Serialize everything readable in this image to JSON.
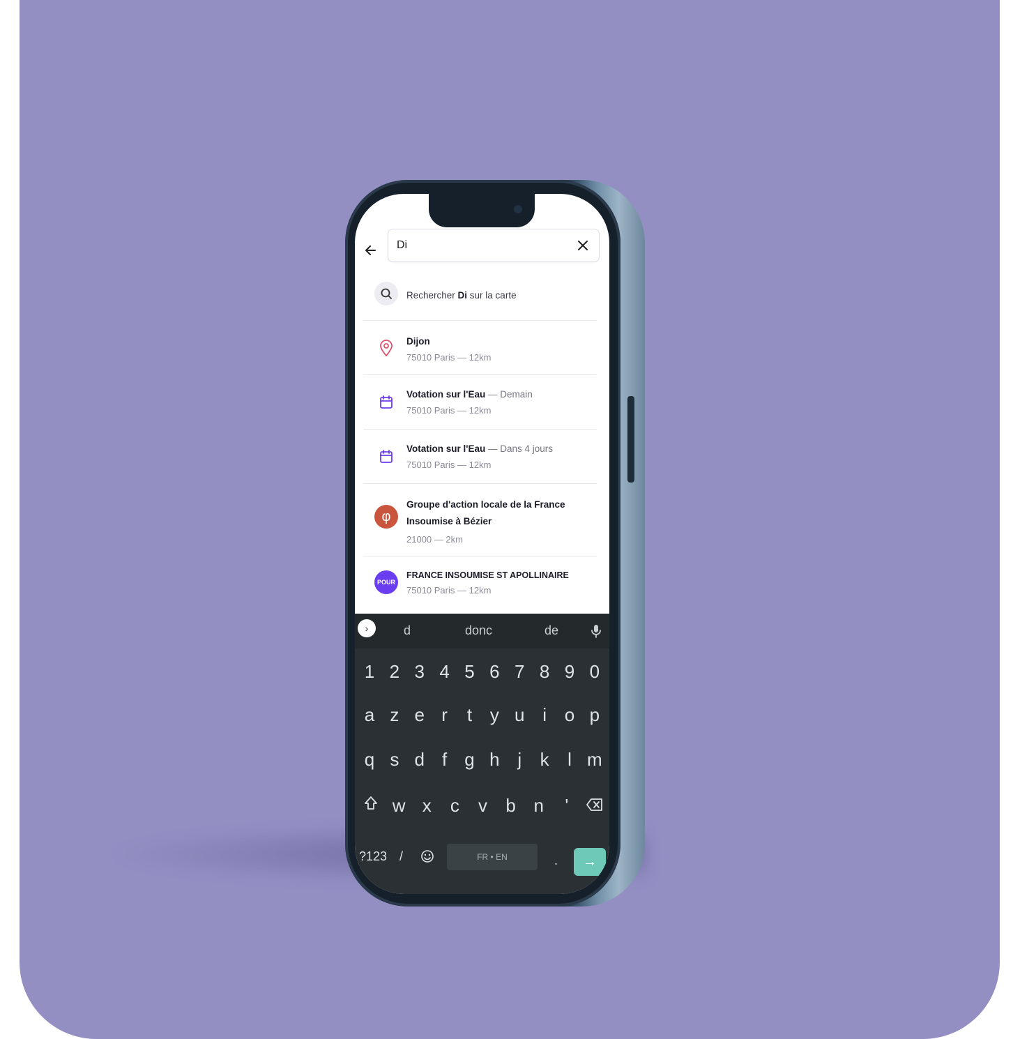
{
  "search": {
    "value": "Di",
    "search_on_map_prefix": "Rechercher ",
    "search_on_map_query": "Di",
    "search_on_map_suffix": " sur la carte"
  },
  "results": [
    {
      "type": "place",
      "icon": "map-pin-icon",
      "title": "Dijon",
      "subtitle": "75010 Paris — 12km"
    },
    {
      "type": "event",
      "icon": "calendar-icon",
      "title": "Votation sur l'Eau",
      "when": " — Demain",
      "subtitle": "75010 Paris — 12km"
    },
    {
      "type": "event",
      "icon": "calendar-icon",
      "title": "Votation sur l'Eau",
      "when": " — Dans 4 jours",
      "subtitle": "75010 Paris — 12km"
    },
    {
      "type": "group",
      "icon": "phi-logo-icon",
      "logo_glyph": "φ",
      "title": "Groupe d'action locale de la France Insoumise à Bézier",
      "subtitle": "21000 — 2km"
    },
    {
      "type": "group",
      "icon": "pour-logo-icon",
      "logo_glyph": "POUR",
      "title": "FRANCE INSOUMISE ST APOLLINAIRE",
      "subtitle": "75010 Paris — 12km"
    }
  ],
  "keyboard": {
    "suggestions": [
      "d",
      "donc",
      "de"
    ],
    "numbers": [
      "1",
      "2",
      "3",
      "4",
      "5",
      "6",
      "7",
      "8",
      "9",
      "0"
    ],
    "row1": [
      "a",
      "z",
      "e",
      "r",
      "t",
      "y",
      "u",
      "i",
      "o",
      "p"
    ],
    "row2": [
      "q",
      "s",
      "d",
      "f",
      "g",
      "h",
      "j",
      "k",
      "l",
      "m"
    ],
    "row3": [
      "w",
      "x",
      "c",
      "v",
      "b",
      "n",
      "'"
    ],
    "symbols_key": "?123",
    "slash_key": "/",
    "space_label": "FR • EN",
    "period_key": ".",
    "enter_glyph": "→"
  },
  "colors": {
    "background": "#938fc3",
    "pin": "#e0526b",
    "calendar": "#6b3df0",
    "enter": "#6ec9b8"
  }
}
